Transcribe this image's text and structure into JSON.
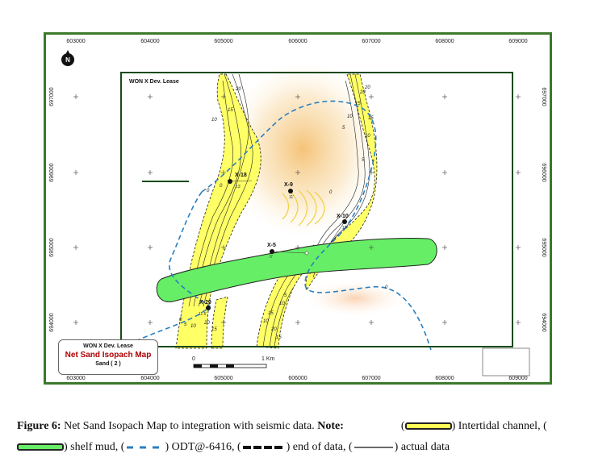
{
  "map": {
    "lease_label": "WON X Dev. Lease",
    "north_symbol": "N",
    "top_x_ticks": [
      "603000",
      "604000",
      "605000",
      "606000",
      "607000",
      "608000",
      "609000"
    ],
    "bottom_x_ticks": [
      "603000",
      "604000",
      "605000",
      "606000",
      "607000",
      "608000",
      "609000"
    ],
    "left_y_ticks": [
      "697000",
      "696000",
      "695000",
      "694000"
    ],
    "right_y_ticks": [
      "697000",
      "696000",
      "695000",
      "694000"
    ],
    "scale_labels": [
      "0",
      "1 Km"
    ],
    "wells": [
      {
        "name": "X-18",
        "value": "13'"
      },
      {
        "name": "X-9",
        "value": "11'"
      },
      {
        "name": "X-10",
        "value": "12'"
      },
      {
        "name": "X-5",
        "value": "0'"
      },
      {
        "name": "X-29",
        "value": "11.5'"
      }
    ],
    "contour_labels": {
      "west_channel": [
        "0",
        "10",
        "15",
        "20",
        "20",
        "15",
        "10",
        "5",
        "0"
      ],
      "east_channel": [
        "0",
        "5",
        "10",
        "15",
        "20",
        "20",
        "15",
        "10",
        "5"
      ],
      "south_channel": [
        "10",
        "15",
        "20",
        "15",
        "10",
        "5"
      ],
      "odt_label": "0",
      "odt_label_2": "0"
    },
    "colors": {
      "channel_fill": "#ffff66",
      "shelf_mud": "#66ee66",
      "odt_line": "#2a7fc0",
      "lease_border": "#1a4a1a",
      "frame_border": "#3a7a2a",
      "seismic_anomaly": "#f5c070"
    }
  },
  "title_box": {
    "line1": "WON X Dev. Lease",
    "line2": "Net Sand Isopach Map",
    "line3": "Sand ( 2 )"
  },
  "caption": {
    "figure_label": "Figure 6:",
    "text": "Net Sand Isopach Map to integration with seismic data.",
    "note_label": "Note:",
    "legend_intertidal": "Intertidal channel,",
    "legend_shelf": "shelf mud,",
    "legend_odt": "ODT@-6416,",
    "legend_end": "end of data,",
    "legend_actual": "actual data"
  }
}
